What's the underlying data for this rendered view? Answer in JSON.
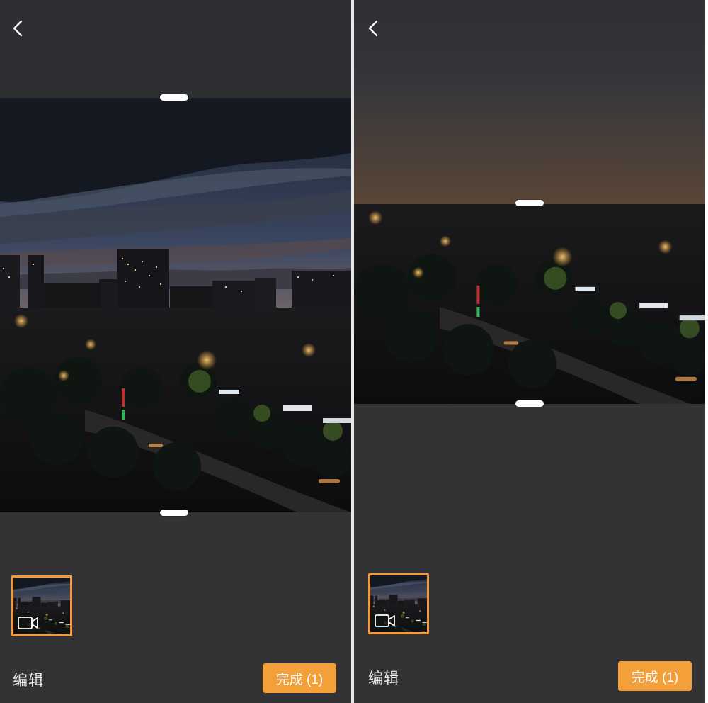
{
  "left_panel": {
    "back_icon": "chevron-left-icon",
    "thumbnail_icon": "video-camera-icon",
    "edit_label": "编辑",
    "done_label": "完成 (1)"
  },
  "right_panel": {
    "back_icon": "chevron-left-icon",
    "thumbnail_icon": "video-camera-icon",
    "edit_label": "编辑",
    "done_label": "完成 (1)"
  },
  "colors": {
    "panel_background": "#333336",
    "accent": "#f3a03a",
    "handle": "#ffffff",
    "text": "#e9e9ea"
  }
}
